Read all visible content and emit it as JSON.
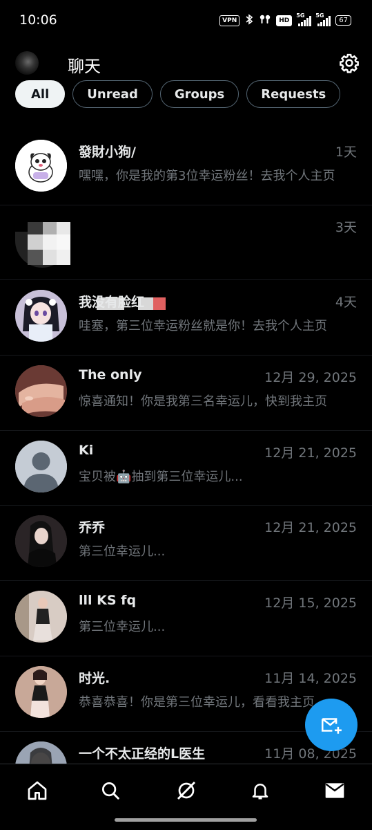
{
  "status_bar": {
    "time": "10:06",
    "vpn": "VPN",
    "hd": "HD",
    "net1": "5G",
    "net2": "5G",
    "battery": "67"
  },
  "header": {
    "title": "聊天",
    "settings_icon": "gear-icon"
  },
  "tabs": [
    {
      "label": "All",
      "active": true
    },
    {
      "label": "Unread",
      "active": false
    },
    {
      "label": "Groups",
      "active": false
    },
    {
      "label": "Requests",
      "active": false
    }
  ],
  "chats": [
    {
      "name": "發財小狗/",
      "time": "1天",
      "preview": "嘿嘿，你是我的第3位幸运粉丝！去我个人主页",
      "avatar": "cartoon-dog"
    },
    {
      "name": "",
      "time": "3天",
      "preview": "",
      "avatar": "blurred"
    },
    {
      "name": "我没有脸红",
      "time": "4天",
      "preview": "哇塞，第三位幸运粉丝就是你！去我个人主页",
      "avatar": "anime-girl"
    },
    {
      "name": "The only",
      "time": "12月 29, 2025",
      "preview": "惊喜通知！你是我第三名幸运儿，快到我主页",
      "avatar": "hands"
    },
    {
      "name": "Ki",
      "time": "12月 21, 2025",
      "preview": "宝贝被🤖抽到第三位幸运儿...",
      "avatar": "default-person"
    },
    {
      "name": "乔乔",
      "time": "12月 21, 2025",
      "preview": "第三位幸运儿...",
      "avatar": "photo"
    },
    {
      "name": "lll KS fq",
      "time": "12月 15, 2025",
      "preview": "第三位幸运儿...",
      "avatar": "photo"
    },
    {
      "name": "时光.",
      "time": "11月 14, 2025",
      "preview": "恭喜恭喜！你是第三位幸运儿，看看我主页",
      "avatar": "photo"
    },
    {
      "name": "一个不太正经的L医生",
      "time": "11月 08, 2025",
      "preview": "",
      "avatar": "photo-mask"
    }
  ],
  "fab": {
    "icon": "new-message-icon"
  },
  "bottom_nav": [
    {
      "icon": "home-icon"
    },
    {
      "icon": "search-icon"
    },
    {
      "icon": "grok-icon"
    },
    {
      "icon": "bell-icon"
    },
    {
      "icon": "mail-icon",
      "active": true
    }
  ]
}
